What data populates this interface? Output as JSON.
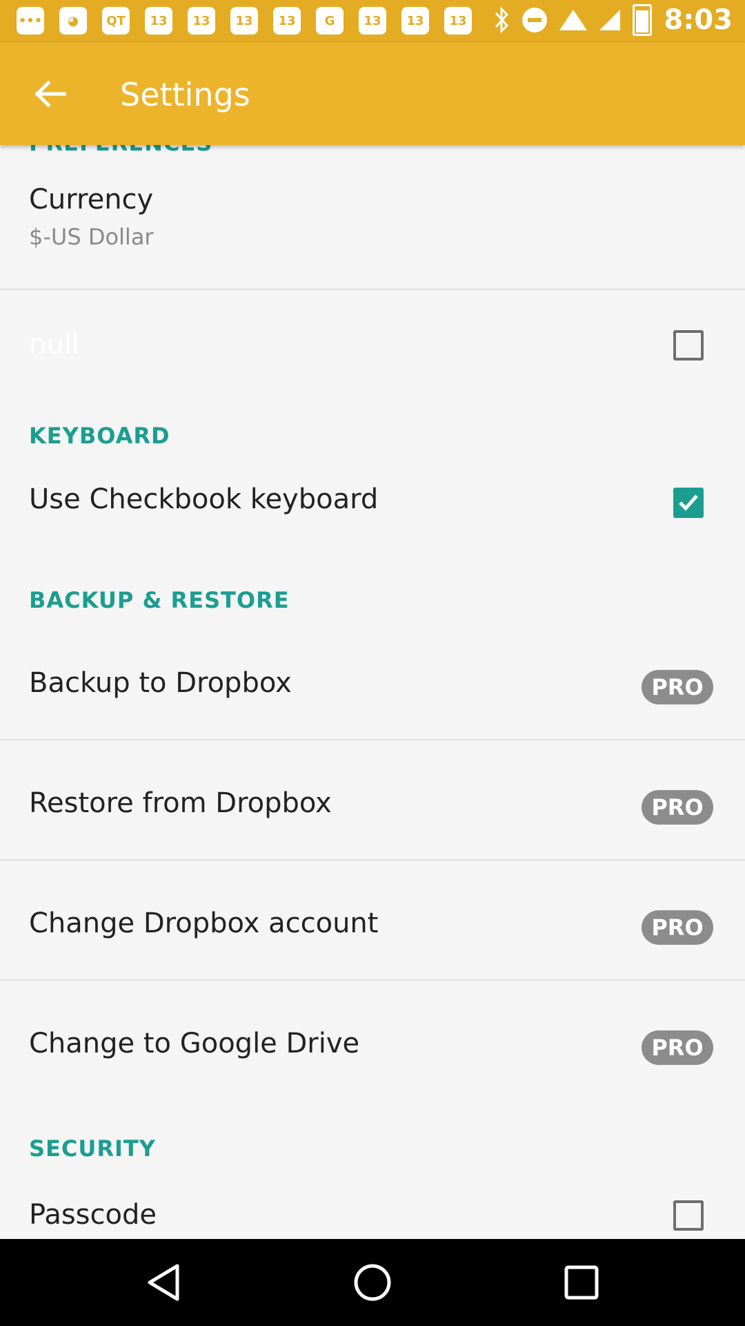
{
  "statusbar": {
    "time": "8:03",
    "left_icons": [
      "chat-icon",
      "pac-icon",
      "QT",
      "13",
      "13",
      "13",
      "13",
      "G",
      "13",
      "13",
      "13"
    ]
  },
  "toolbar": {
    "title": "Settings"
  },
  "sections": {
    "preferences": "PREFERENCES",
    "keyboard": "KEYBOARD",
    "backup": "BACKUP & RESTORE",
    "security": "SECURITY"
  },
  "rows": {
    "currency": {
      "label": "Currency",
      "value": "$-US Dollar"
    },
    "null_item": {
      "label": "null",
      "checked": false
    },
    "keyboard": {
      "label": "Use Checkbook keyboard",
      "checked": true
    },
    "backup_dropbox": {
      "label": "Backup to Dropbox",
      "badge": "PRO"
    },
    "restore_dropbox": {
      "label": "Restore from Dropbox",
      "badge": "PRO"
    },
    "change_dropbox": {
      "label": "Change Dropbox account",
      "badge": "PRO"
    },
    "google_drive": {
      "label": "Change to Google Drive",
      "badge": "PRO"
    },
    "passcode": {
      "label": "Passcode",
      "checked": false
    }
  },
  "colors": {
    "accent": "#1b9e90",
    "toolbar": "#ecb42a",
    "statusbar": "#e3ac22"
  }
}
